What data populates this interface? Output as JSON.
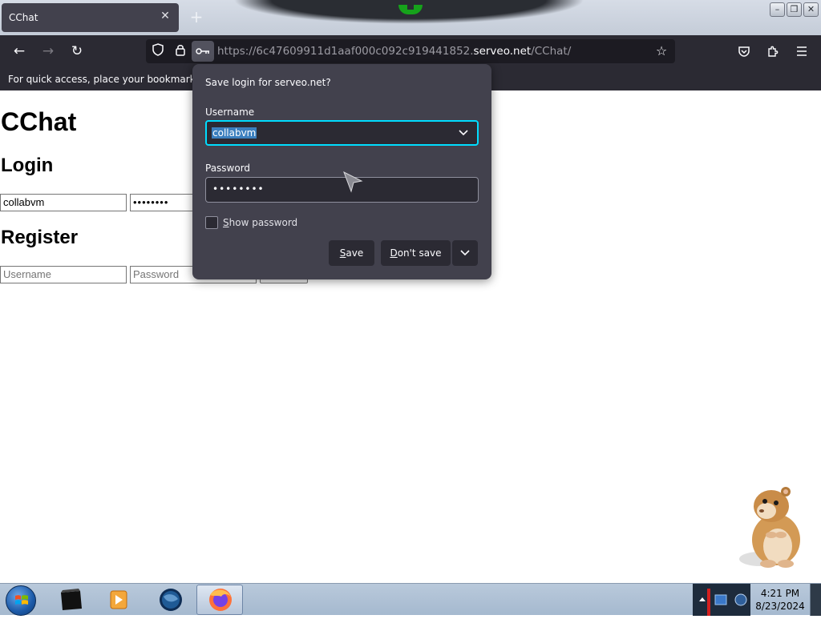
{
  "tab": {
    "title": "CChat",
    "close_symbol": "✕",
    "new_tab_symbol": "+"
  },
  "window_controls": {
    "minimize": "–",
    "restore": "❐",
    "close": "✕"
  },
  "nav": {
    "back_symbol": "←",
    "forward_symbol": "→",
    "reload_symbol": "↻",
    "url_prefix": "https://6c47609911d1aaf000c092c919441852.",
    "url_host": "serveo.net",
    "url_path": "/CChat/",
    "star_symbol": "☆"
  },
  "bookmarks_bar": {
    "text": "For quick access, place your bookmarks her"
  },
  "page": {
    "title": "CChat",
    "login_heading": "Login",
    "login_username_value": "collabvm",
    "login_password_value": "••••••••",
    "register_heading": "Register",
    "register_username_placeholder": "Username",
    "register_password_placeholder": "Password"
  },
  "save_login_panel": {
    "title": "Save login for serveo.net?",
    "username_label": "Username",
    "username_value": "collabvm",
    "password_label": "Password",
    "password_value": "••••••••",
    "show_password_label_first": "S",
    "show_password_label_rest": "how password",
    "show_password_checked": false,
    "save_button_first": "S",
    "save_button_rest": "ave",
    "dont_save_button_first": "D",
    "dont_save_button_rest": "on't save",
    "chevron_symbol": "⌄"
  },
  "taskbar": {
    "items": [
      "start-orb",
      "desktop-app",
      "media-player",
      "globe-app",
      "firefox"
    ],
    "active_item": "firefox",
    "clock_time": "4:21 PM",
    "clock_date": "8/23/2024"
  },
  "colors": {
    "panel_bg": "#42414d",
    "toolbar_bg": "#2b2a33",
    "focus_ring": "#00ddff",
    "selection": "#3b7fbe",
    "camera_green": "#16a21b"
  }
}
